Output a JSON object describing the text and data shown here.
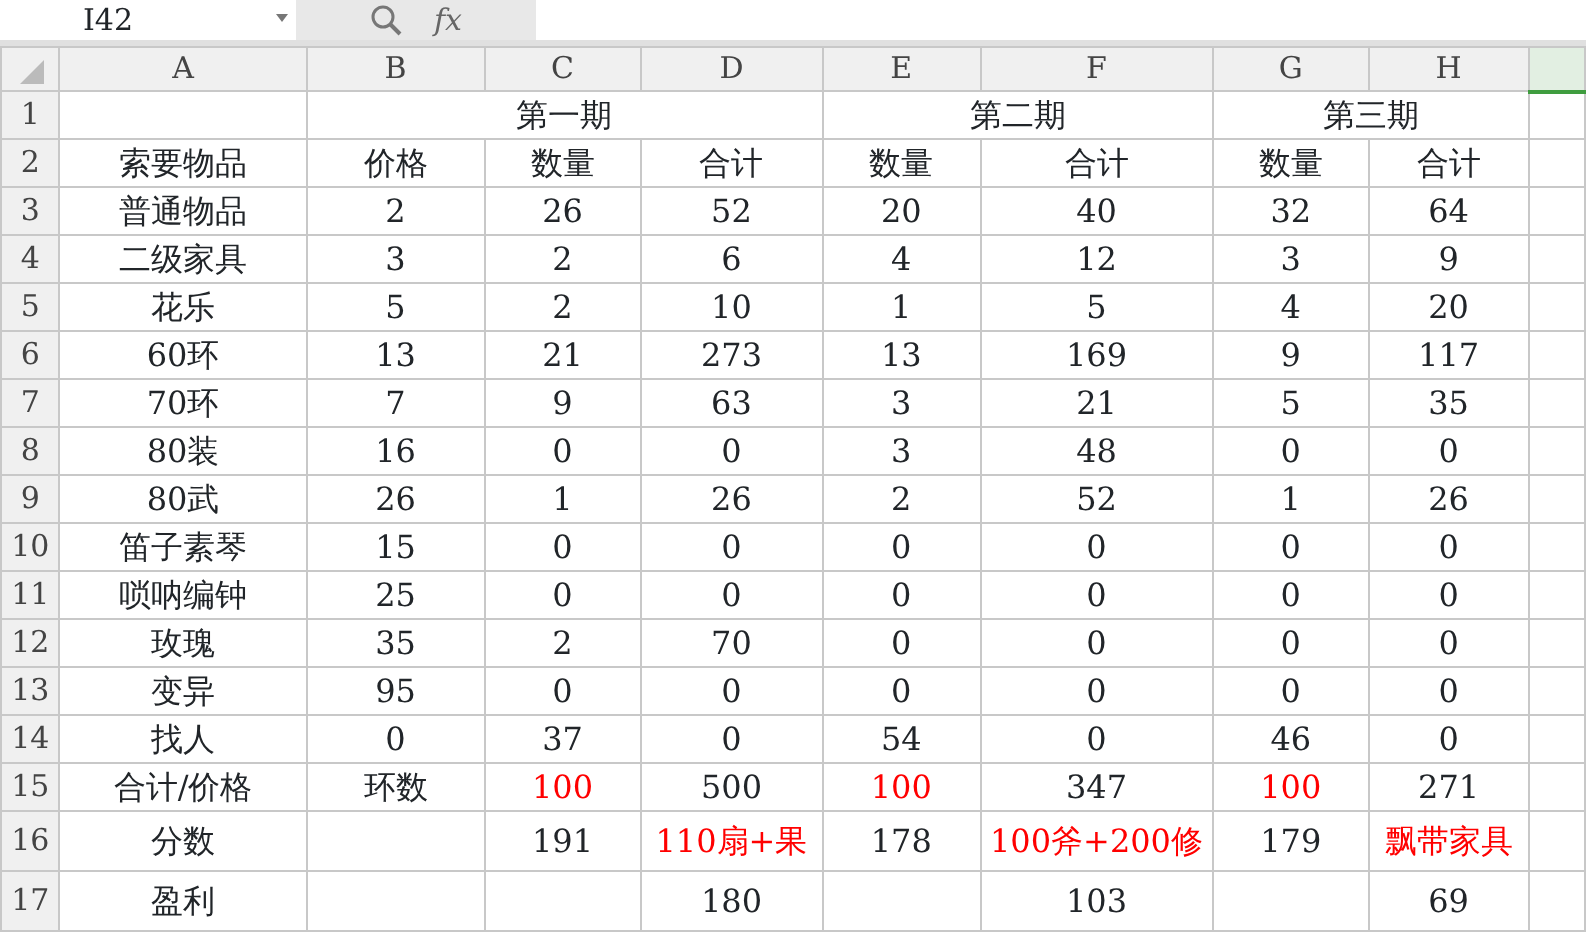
{
  "name_box": {
    "value": "I42"
  },
  "formula_bar": {
    "function_label": "fx"
  },
  "columns": [
    "A",
    "B",
    "C",
    "D",
    "E",
    "F",
    "G",
    "H"
  ],
  "rows": [
    {
      "number": "1",
      "cells": [
        null,
        {
          "text": "第一期"
        },
        {
          "text": "第二期"
        },
        {
          "text": "第三期"
        }
      ]
    },
    {
      "number": "2",
      "cells": [
        {
          "text": "索要物品"
        },
        {
          "text": "价格"
        },
        {
          "text": "数量"
        },
        {
          "text": "合计"
        },
        {
          "text": "数量"
        },
        {
          "text": "合计"
        },
        {
          "text": "数量"
        },
        {
          "text": "合计"
        }
      ]
    },
    {
      "number": "3",
      "cells": [
        {
          "text": "普通物品"
        },
        {
          "text": "2"
        },
        {
          "text": "26"
        },
        {
          "text": "52"
        },
        {
          "text": "20"
        },
        {
          "text": "40"
        },
        {
          "text": "32"
        },
        {
          "text": "64"
        }
      ]
    },
    {
      "number": "4",
      "cells": [
        {
          "text": "二级家具"
        },
        {
          "text": "3"
        },
        {
          "text": "2"
        },
        {
          "text": "6"
        },
        {
          "text": "4"
        },
        {
          "text": "12"
        },
        {
          "text": "3"
        },
        {
          "text": "9"
        }
      ]
    },
    {
      "number": "5",
      "cells": [
        {
          "text": "花乐"
        },
        {
          "text": "5"
        },
        {
          "text": "2"
        },
        {
          "text": "10"
        },
        {
          "text": "1"
        },
        {
          "text": "5"
        },
        {
          "text": "4"
        },
        {
          "text": "20"
        }
      ]
    },
    {
      "number": "6",
      "cells": [
        {
          "text": "60环"
        },
        {
          "text": "13"
        },
        {
          "text": "21"
        },
        {
          "text": "273"
        },
        {
          "text": "13"
        },
        {
          "text": "169"
        },
        {
          "text": "9"
        },
        {
          "text": "117"
        }
      ]
    },
    {
      "number": "7",
      "cells": [
        {
          "text": "70环"
        },
        {
          "text": "7"
        },
        {
          "text": "9"
        },
        {
          "text": "63"
        },
        {
          "text": "3"
        },
        {
          "text": "21"
        },
        {
          "text": "5"
        },
        {
          "text": "35"
        }
      ]
    },
    {
      "number": "8",
      "cells": [
        {
          "text": "80装"
        },
        {
          "text": "16"
        },
        {
          "text": "0"
        },
        {
          "text": "0"
        },
        {
          "text": "3"
        },
        {
          "text": "48"
        },
        {
          "text": "0"
        },
        {
          "text": "0"
        }
      ]
    },
    {
      "number": "9",
      "cells": [
        {
          "text": "80武"
        },
        {
          "text": "26"
        },
        {
          "text": "1"
        },
        {
          "text": "26"
        },
        {
          "text": "2"
        },
        {
          "text": "52"
        },
        {
          "text": "1"
        },
        {
          "text": "26"
        }
      ]
    },
    {
      "number": "10",
      "cells": [
        {
          "text": "笛子素琴"
        },
        {
          "text": "15"
        },
        {
          "text": "0"
        },
        {
          "text": "0"
        },
        {
          "text": "0"
        },
        {
          "text": "0"
        },
        {
          "text": "0"
        },
        {
          "text": "0"
        }
      ]
    },
    {
      "number": "11",
      "cells": [
        {
          "text": "唢呐编钟"
        },
        {
          "text": "25"
        },
        {
          "text": "0"
        },
        {
          "text": "0"
        },
        {
          "text": "0"
        },
        {
          "text": "0"
        },
        {
          "text": "0"
        },
        {
          "text": "0"
        }
      ]
    },
    {
      "number": "12",
      "cells": [
        {
          "text": "玫瑰"
        },
        {
          "text": "35"
        },
        {
          "text": "2"
        },
        {
          "text": "70"
        },
        {
          "text": "0"
        },
        {
          "text": "0"
        },
        {
          "text": "0"
        },
        {
          "text": "0"
        }
      ]
    },
    {
      "number": "13",
      "cells": [
        {
          "text": "变异"
        },
        {
          "text": "95"
        },
        {
          "text": "0"
        },
        {
          "text": "0"
        },
        {
          "text": "0"
        },
        {
          "text": "0"
        },
        {
          "text": "0"
        },
        {
          "text": "0"
        }
      ]
    },
    {
      "number": "14",
      "cells": [
        {
          "text": "找人"
        },
        {
          "text": "0"
        },
        {
          "text": "37"
        },
        {
          "text": "0"
        },
        {
          "text": "54"
        },
        {
          "text": "0"
        },
        {
          "text": "46"
        },
        {
          "text": "0"
        }
      ]
    },
    {
      "number": "15",
      "cells": [
        {
          "text": "合计/价格"
        },
        {
          "text": "环数"
        },
        {
          "text": "100",
          "color": "#ff0000"
        },
        {
          "text": "500"
        },
        {
          "text": "100",
          "color": "#ff0000"
        },
        {
          "text": "347"
        },
        {
          "text": "100",
          "color": "#ff0000"
        },
        {
          "text": "271"
        }
      ]
    },
    {
      "number": "16",
      "cells": [
        {
          "text": "分数"
        },
        null,
        {
          "text": "191"
        },
        {
          "text": "110扇+果",
          "color": "#ff0000"
        },
        {
          "text": "178"
        },
        {
          "text": "100斧+200修",
          "color": "#ff0000"
        },
        {
          "text": "179"
        },
        {
          "text": "飘带家具",
          "color": "#ff0000"
        }
      ]
    },
    {
      "number": "17",
      "cells": [
        {
          "text": "盈利"
        },
        null,
        null,
        {
          "text": "180"
        },
        null,
        {
          "text": "103"
        },
        null,
        {
          "text": "69"
        }
      ]
    }
  ]
}
